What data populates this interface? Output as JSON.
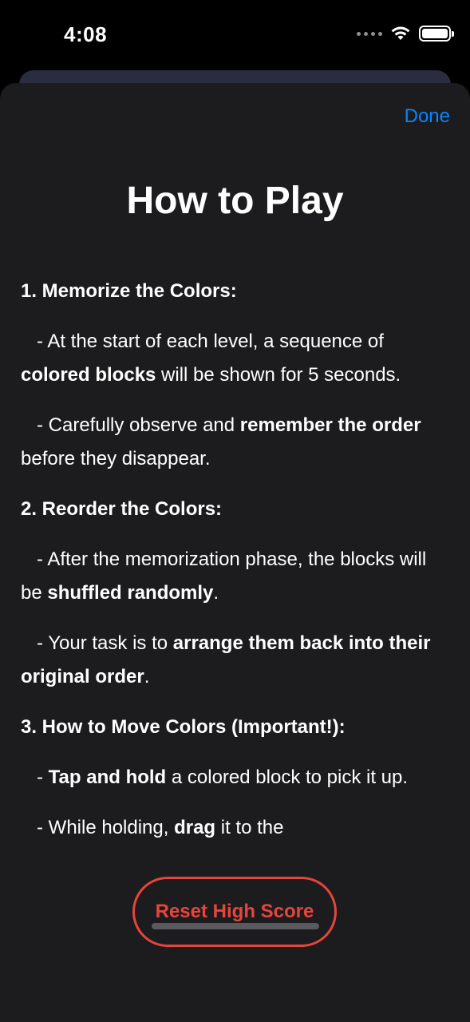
{
  "status_bar": {
    "time": "4:08"
  },
  "sheet": {
    "done_label": "Done",
    "title": "How to Play",
    "sections": [
      {
        "heading": "1. Memorize the Colors:"
      },
      {
        "heading": "2. Reorder the Colors:"
      },
      {
        "heading": "3. How to Move Colors (Important!):"
      }
    ],
    "paragraphs": {
      "p1": {
        "a": "- At the start of each level, a sequence of ",
        "b": "colored blocks",
        "c": " will be shown for 5 seconds."
      },
      "p2": {
        "a": "- Carefully observe and ",
        "b": "remember the order",
        "c": " before they disappear."
      },
      "p3": {
        "a": "- After the memorization phase, the blocks will be ",
        "b": "shuffled randomly",
        "c": "."
      },
      "p4": {
        "a": "- Your task is to ",
        "b": "arrange them back into their original order",
        "c": "."
      },
      "p5": {
        "a": "- ",
        "b": "Tap and hold",
        "c": " a colored block to pick it up."
      },
      "p6": {
        "a": "- While holding, ",
        "b": "drag",
        "c": " it to the"
      }
    },
    "reset_label": "Reset High Score"
  },
  "colors": {
    "accent": "#0a84ff",
    "destructive": "#e5453b",
    "sheet_bg": "#1c1c1e"
  }
}
